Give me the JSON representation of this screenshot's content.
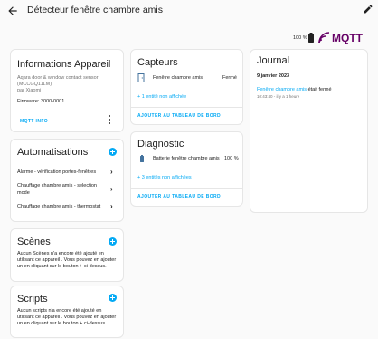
{
  "header": {
    "title": "Détecteur fenêtre chambre amis"
  },
  "status": {
    "battery": "100 %",
    "integration_logo": "MQTT"
  },
  "info_card": {
    "title": "Informations Appareil",
    "model": "Aqara door & window contact sensor",
    "model_code": "(MCCGQ11LM)",
    "manufacturer": "par Xiaomi",
    "firmware": "Firmware: 3000-0001",
    "button": "MQTT INFO"
  },
  "automations_card": {
    "title": "Automatisations",
    "items": [
      "Alarme - vérification portes-fenêtres",
      "Chauffage chambre amis - selection",
      "mode",
      "Chauffage chambre amis - thermostat"
    ]
  },
  "scenes_card": {
    "title": "Scènes",
    "line1": "Aucun Scènes n'a encore été ajouté en",
    "line2": "utilisant ce appareil . Vous pouvez en ajouter",
    "line3": "un en cliquant sur le bouton + ci-dessus."
  },
  "scripts_card": {
    "title": "Scripts",
    "line1": "Aucun scripts n'a encore été ajouté en",
    "line2": "utilisant ce appareil . Vous pouvez en ajouter",
    "line3": "un en cliquant sur le bouton + ci-dessus."
  },
  "sensors_card": {
    "title": "Capteurs",
    "entity": "Fenêtre chambre amis",
    "state": "Fermé",
    "hidden": "+ 1 entité non affichée",
    "button": "AJOUTER AU TABLEAU DE BORD"
  },
  "diagnostic_card": {
    "title": "Diagnostic",
    "entity": "Batterie fenêtre chambre amis",
    "state": "100 %",
    "hidden": "+ 3 entités non affichées",
    "button": "AJOUTER AU TABLEAU DE BORD"
  },
  "journal_card": {
    "title": "Journal",
    "date": "9 janvier 2023",
    "entry_link": "Fenêtre chambre amis",
    "entry_text": "était fermé",
    "entry_time": "10:43:40 - il y a 1 heure"
  },
  "colors": {
    "accent": "#03a9f4",
    "mqtt": "#660066"
  }
}
